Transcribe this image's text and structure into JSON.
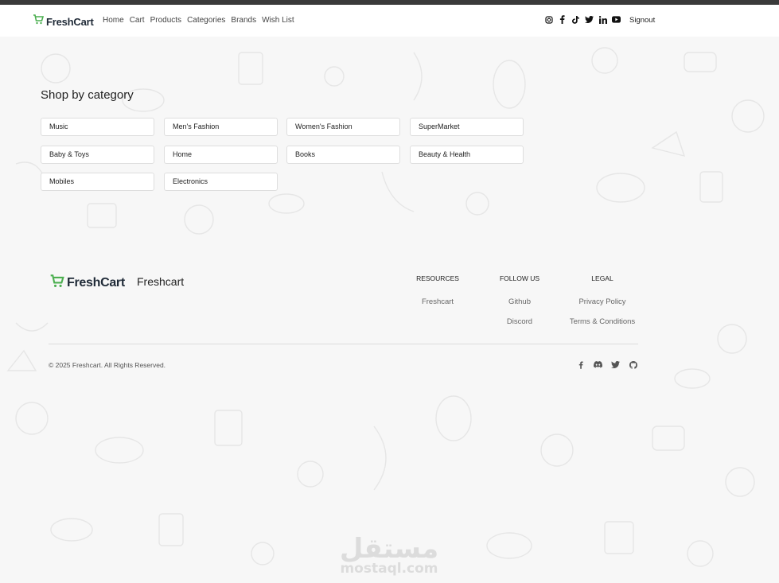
{
  "brand": {
    "name": "FreshCart",
    "accent_color": "#4caf50",
    "icon": "cart-icon"
  },
  "nav": {
    "items": [
      "Home",
      "Cart",
      "Products",
      "Categories",
      "Brands",
      "Wish List"
    ],
    "signout": "Signout"
  },
  "social_top": [
    "instagram-icon",
    "facebook-icon",
    "tiktok-icon",
    "twitter-icon",
    "linkedin-icon",
    "youtube-icon"
  ],
  "section": {
    "title": "Shop by category"
  },
  "categories": [
    "Music",
    "Men's Fashion",
    "Women's Fashion",
    "SuperMarket",
    "Baby & Toys",
    "Home",
    "Books",
    "Beauty & Health",
    "Mobiles",
    "Electronics"
  ],
  "footer": {
    "brand": "FreshCart",
    "title": "Freshcart",
    "columns": [
      {
        "heading": "RESOURCES",
        "links": [
          "Freshcart"
        ]
      },
      {
        "heading": "FOLLOW US",
        "links": [
          "Github",
          "Discord"
        ]
      },
      {
        "heading": "LEGAL",
        "links": [
          "Privacy Policy",
          "Terms & Conditions"
        ]
      }
    ],
    "copyright": "© 2025 Freshcart. All Rights Reserved.",
    "social": [
      "facebook-icon",
      "discord-icon",
      "twitter-icon",
      "github-icon"
    ]
  }
}
